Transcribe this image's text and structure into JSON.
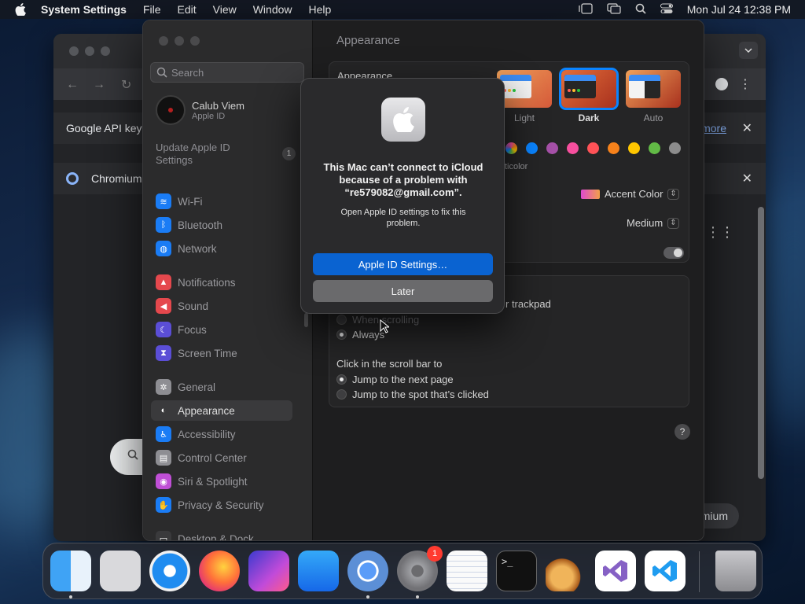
{
  "menubar": {
    "app": "System Settings",
    "menus": [
      "File",
      "Edit",
      "View",
      "Window",
      "Help"
    ],
    "clock": "Mon Jul 24  12:38 PM",
    "status_icons": [
      "stage-manager-icon",
      "screen-mirroring-icon",
      "search-icon",
      "control-center-icon"
    ]
  },
  "browser": {
    "banner_text": "Google API keys",
    "banner_link": "more",
    "tab_text": "Chromium",
    "pill_text": "mium"
  },
  "sidebar": {
    "search_placeholder": "Search",
    "profile": {
      "name": "Calub Viem",
      "subtitle": "Apple ID"
    },
    "update": {
      "label": "Update Apple ID Settings",
      "badge": "1"
    },
    "items": [
      {
        "label": "Wi-Fi",
        "icon": "wifi-icon",
        "color": "#1a7cf5"
      },
      {
        "label": "Bluetooth",
        "icon": "bluetooth-icon",
        "color": "#1a7cf5"
      },
      {
        "label": "Network",
        "icon": "globe-icon",
        "color": "#1a7cf5"
      },
      {
        "label": "Notifications",
        "icon": "bell-icon",
        "color": "#e5484d"
      },
      {
        "label": "Sound",
        "icon": "speaker-icon",
        "color": "#e5484d"
      },
      {
        "label": "Focus",
        "icon": "moon-icon",
        "color": "#5b4ed6"
      },
      {
        "label": "Screen Time",
        "icon": "hourglass-icon",
        "color": "#5b4ed6"
      },
      {
        "label": "General",
        "icon": "gear-icon",
        "color": "#8e8e93"
      },
      {
        "label": "Appearance",
        "icon": "appearance-icon",
        "color": "#3a3a3c"
      },
      {
        "label": "Accessibility",
        "icon": "accessibility-icon",
        "color": "#1a7cf5"
      },
      {
        "label": "Control Center",
        "icon": "control-center-icon",
        "color": "#8e8e93"
      },
      {
        "label": "Siri & Spotlight",
        "icon": "siri-icon",
        "color": "#c04fd6"
      },
      {
        "label": "Privacy & Security",
        "icon": "hand-icon",
        "color": "#1a7cf5"
      },
      {
        "label": "Desktop & Dock",
        "icon": "dock-icon",
        "color": "#3a3a3c"
      }
    ],
    "selected": "Appearance"
  },
  "main": {
    "title": "Appearance",
    "appearance_label": "Appearance",
    "themes": [
      {
        "label": "Light"
      },
      {
        "label": "Dark"
      },
      {
        "label": "Auto"
      }
    ],
    "selected_theme": "Dark",
    "multicolor_label": "ticolor",
    "accent_colors": [
      "#c75bd6",
      "#0a84ff",
      "#a550a7",
      "#f74f9e",
      "#ff5257",
      "#f7821b",
      "#ffc600",
      "#62ba46",
      "#8c8c8c"
    ],
    "accent_color_label": "Accent Color",
    "sidebar_icon_size": "Medium",
    "trackpad_fragment": "r trackpad",
    "scroll_options": [
      "When scrolling",
      "Always"
    ],
    "scroll_selected": "Always",
    "click_label": "Click in the scroll bar to",
    "click_options": [
      "Jump to the next page",
      "Jump to the spot that’s clicked"
    ],
    "click_selected": "Jump to the next page",
    "help": "?"
  },
  "dialog": {
    "message": "This Mac can’t connect to iCloud because of a problem with “re579082@gmail.com”.",
    "submessage": "Open Apple ID settings to fix this problem.",
    "primary_button": "Apple ID Settings…",
    "secondary_button": "Later"
  },
  "dock": {
    "apps": [
      {
        "name": "finder",
        "icon": "finder-icon",
        "running": true
      },
      {
        "name": "launchpad",
        "icon": "launchpad-icon",
        "running": false
      },
      {
        "name": "safari",
        "icon": "safari-icon",
        "running": false
      },
      {
        "name": "firefox",
        "icon": "firefox-icon",
        "running": false
      },
      {
        "name": "shortcuts",
        "icon": "shortcuts-icon",
        "running": false
      },
      {
        "name": "app-store",
        "icon": "app-store-icon",
        "running": false
      },
      {
        "name": "chromium",
        "icon": "chromium-icon",
        "running": true
      },
      {
        "name": "system-settings",
        "icon": "settings-icon",
        "running": true,
        "badge": "1"
      },
      {
        "name": "textedit",
        "icon": "notepad-icon",
        "running": false
      },
      {
        "name": "terminal",
        "icon": "terminal-icon",
        "running": false
      },
      {
        "name": "instruments",
        "icon": "guitar-icon",
        "running": false
      },
      {
        "name": "visual-studio",
        "icon": "visual-studio-icon",
        "running": false
      },
      {
        "name": "vscode",
        "icon": "vscode-icon",
        "running": false
      },
      {
        "name": "trash",
        "icon": "trash-icon",
        "running": false
      }
    ]
  }
}
